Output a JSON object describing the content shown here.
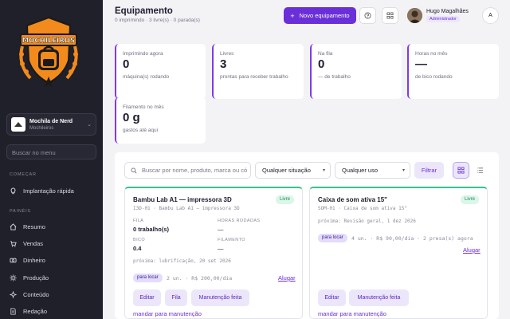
{
  "sidebar": {
    "logo_text": "MOCHILEIROS",
    "org": {
      "name": "Mochila de Nerd",
      "sub": "Mochileiros"
    },
    "search_placeholder": "Buscar no menu",
    "sections": [
      {
        "label": "COMEÇAR",
        "items": [
          {
            "label": "Implantação rápida",
            "icon": "lightbulb-icon"
          }
        ]
      },
      {
        "label": "PAINÉIS",
        "items": [
          {
            "label": "Resumo",
            "icon": "home-icon"
          },
          {
            "label": "Vendas",
            "icon": "cart-icon"
          },
          {
            "label": "Dinheiro",
            "icon": "money-icon"
          },
          {
            "label": "Produção",
            "icon": "gear-icon"
          },
          {
            "label": "Conteúdo",
            "icon": "sparkle-icon"
          },
          {
            "label": "Redação",
            "icon": "document-icon"
          }
        ]
      }
    ]
  },
  "header": {
    "title": "Equipamento",
    "subtitle": "0 imprimindo · 3 livre(s) · 0 parada(s)",
    "new_button": "Novo equipamento",
    "user": {
      "name": "Hugo Magalhães",
      "role": "Administrador",
      "initial": "A"
    }
  },
  "stats": [
    {
      "label": "Imprimindo agora",
      "value": "0",
      "sub": "máquina(s) rodando"
    },
    {
      "label": "Livres",
      "value": "3",
      "sub": "prontas para receber trabalho"
    },
    {
      "label": "Na fila",
      "value": "0",
      "sub": "— de trabalho"
    },
    {
      "label": "Horas no mês",
      "value": "—",
      "sub": "de bico rodando"
    },
    {
      "label": "Filamento no mês",
      "value": "0 g",
      "sub": "gastos até aqui"
    }
  ],
  "filters": {
    "search_placeholder": "Buscar por nome, produto, marca ou có",
    "situation": "Qualquer situação",
    "usage": "Qualquer uso",
    "filter_button": "Filtrar"
  },
  "equipment": [
    {
      "title": "Bambu Lab A1 — impressora 3D",
      "code": "I3D-01 · Bambu Lab A1 — impressora 3D",
      "status": "Livre",
      "fila_label": "FILA",
      "fila_value": "0 trabalho(s)",
      "horas_label": "HORAS RODADAS",
      "horas_value": "—",
      "bico_label": "BICO",
      "bico_value": "0.4",
      "filamento_label": "FILAMENTO",
      "filamento_value": "—",
      "next": "próxima: lubrificação, 20 set 2026",
      "tag": "para locar",
      "tag_info": "2 un. · R$ 200,00/dia",
      "rent": "Alugar",
      "edit": "Editar",
      "queue": "Fila",
      "maintenance_done": "Manutenção feita",
      "send_maintenance": "mandar para manutenção"
    },
    {
      "title": "Caixa de som ativa 15\"",
      "code": "SOM-01 · Caixa de som ativa 15\"",
      "status": "Livre",
      "next": "próxima: Revisão geral, 1 dez 2026",
      "tag": "para locar",
      "tag_info": "4 un. · R$ 90,00/dia · 2 presa(s) agora",
      "rent": "Alugar",
      "edit": "Editar",
      "maintenance_done": "Manutenção feita",
      "send_maintenance": "mandar para manutenção"
    }
  ],
  "colors": {
    "accent": "#6a2fd9",
    "sidebar": "#1f2029",
    "free": "#34c38f"
  }
}
